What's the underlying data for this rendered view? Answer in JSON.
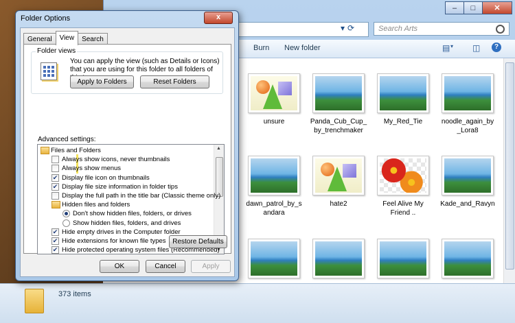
{
  "explorer": {
    "search_placeholder": "Search Arts",
    "toolbar": {
      "burn": "Burn",
      "new_folder": "New folder"
    },
    "items": [
      {
        "label": "unsure",
        "kind": "shapes"
      },
      {
        "label": "Panda_Cub_Cup_\nby_trenchmaker",
        "kind": "landscape"
      },
      {
        "label": "My_Red_Tie",
        "kind": "landscape"
      },
      {
        "label": "noodle_again_by\n_Lora8",
        "kind": "landscape"
      },
      {
        "label": "dawn_patrol_by_s\nandara",
        "kind": "landscape"
      },
      {
        "label": "hate2",
        "kind": "shapes"
      },
      {
        "label": "Feel Alive My\nFriend ..",
        "kind": "flowers"
      },
      {
        "label": "Kade_and_Ravyn",
        "kind": "landscape"
      }
    ],
    "status": {
      "count": "373 items"
    }
  },
  "dialog": {
    "title": "Folder Options",
    "close": "x",
    "tabs": [
      {
        "label": "General",
        "active": false
      },
      {
        "label": "View",
        "active": true
      },
      {
        "label": "Search",
        "active": false
      }
    ],
    "folder_views": {
      "title": "Folder views",
      "description": "You can apply the view (such as Details or Icons) that you are using for this folder to all folders of this type.",
      "apply_button": "Apply to Folders",
      "reset_button": "Reset Folders"
    },
    "advanced_label": "Advanced settings:",
    "settings": [
      {
        "type": "folder",
        "indent": 0,
        "label": "Files and Folders"
      },
      {
        "type": "checkbox",
        "indent": 1,
        "checked": false,
        "label": "Always show icons, never thumbnails"
      },
      {
        "type": "checkbox",
        "indent": 1,
        "checked": false,
        "label": "Always show menus"
      },
      {
        "type": "checkbox",
        "indent": 1,
        "checked": true,
        "label": "Display file icon on thumbnails"
      },
      {
        "type": "checkbox",
        "indent": 1,
        "checked": true,
        "label": "Display file size information in folder tips"
      },
      {
        "type": "checkbox",
        "indent": 1,
        "checked": false,
        "label": "Display the full path in the title bar (Classic theme only)"
      },
      {
        "type": "folder",
        "indent": 1,
        "label": "Hidden files and folders"
      },
      {
        "type": "radio",
        "indent": 2,
        "checked": true,
        "label": "Don't show hidden files, folders, or drives"
      },
      {
        "type": "radio",
        "indent": 2,
        "checked": false,
        "label": "Show hidden files, folders, and drives"
      },
      {
        "type": "checkbox",
        "indent": 1,
        "checked": true,
        "label": "Hide empty drives in the Computer folder"
      },
      {
        "type": "checkbox",
        "indent": 1,
        "checked": true,
        "label": "Hide extensions for known file types"
      },
      {
        "type": "checkbox",
        "indent": 1,
        "checked": true,
        "label": "Hide protected operating system files (Recommended)"
      }
    ],
    "restore_button": "Restore Defaults",
    "ok_button": "OK",
    "cancel_button": "Cancel",
    "apply_button": "Apply"
  }
}
